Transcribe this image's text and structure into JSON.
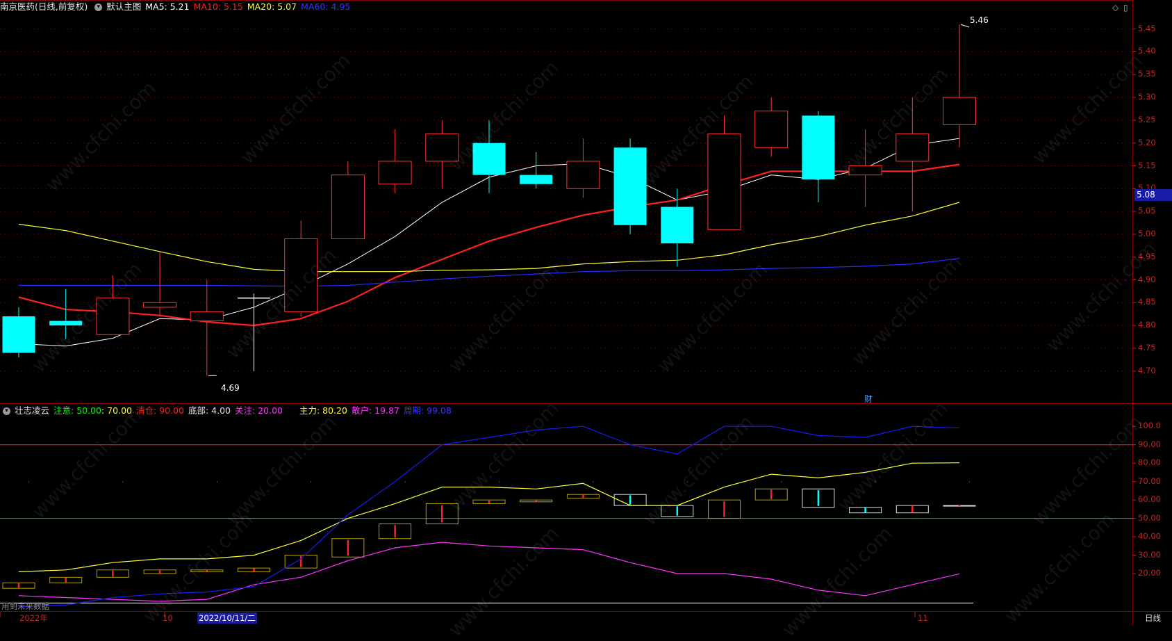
{
  "header": {
    "title": "南京医药(日线,前复权)",
    "template": "默认主图",
    "ma5": "MA5: 5.21",
    "ma10": "MA10: 5.15",
    "ma20": "MA20: 5.07",
    "ma60": "MA60: 4.95"
  },
  "indicator_header": {
    "name": "壮志凌云",
    "attention": "注意: 50.00",
    "attention2": ": 70.00",
    "clear": "清仓: 90.00",
    "bottom": "底部: 4.00",
    "focus": "关注: 20.00",
    "main_force": "主力: 80.20",
    "retail": "散户: 19.87",
    "trend": "周期: 99.08"
  },
  "price_axis": {
    "ticks": [
      "5.45",
      "5.40",
      "5.35",
      "5.30",
      "5.25",
      "5.20",
      "5.15",
      "5.10",
      "5.05",
      "5.00",
      "4.95",
      "4.90",
      "4.85",
      "4.80",
      "4.75",
      "4.70"
    ],
    "current": "5.08"
  },
  "indicator_axis": {
    "ticks": [
      "100.0",
      "90.00",
      "80.00",
      "70.00",
      "60.00",
      "50.00",
      "40.00",
      "30.00",
      "20.00"
    ]
  },
  "annotations": {
    "high": "5.46",
    "low": "4.69",
    "cai": "财",
    "future_data": "用到未来数据"
  },
  "x_axis": {
    "year": "2022年",
    "oct": "10",
    "cursor_date": "2022/10/11/二",
    "nov": "11",
    "period": "日线"
  },
  "watermark": "www.cfchi.com",
  "colors": {
    "up": "#ff3333",
    "down": "#00ffff",
    "ma5": "#ffffff",
    "ma10": "#ff2020",
    "ma20": "#ffff33",
    "ma60": "#2a2aff",
    "retail": "#ff33ff"
  },
  "chart_data": [
    {
      "type": "candlestick",
      "title": "南京医药(日线,前复权)",
      "ylim": [
        4.66,
        5.48
      ],
      "candles": [
        {
          "o": 4.82,
          "h": 4.84,
          "l": 4.73,
          "c": 4.74
        },
        {
          "o": 4.81,
          "h": 4.88,
          "l": 4.77,
          "c": 4.8
        },
        {
          "o": 4.78,
          "h": 4.91,
          "l": 4.78,
          "c": 4.86
        },
        {
          "o": 4.84,
          "h": 4.96,
          "l": 4.82,
          "c": 4.85
        },
        {
          "o": 4.81,
          "h": 4.9,
          "l": 4.69,
          "c": 4.83
        },
        {
          "o": 4.86,
          "h": 4.87,
          "l": 4.7,
          "c": 4.86
        },
        {
          "o": 4.83,
          "h": 5.03,
          "l": 4.82,
          "c": 4.99
        },
        {
          "o": 4.99,
          "h": 5.16,
          "l": 4.99,
          "c": 5.13
        },
        {
          "o": 5.11,
          "h": 5.23,
          "l": 5.09,
          "c": 5.16
        },
        {
          "o": 5.16,
          "h": 5.25,
          "l": 5.1,
          "c": 5.22
        },
        {
          "o": 5.2,
          "h": 5.25,
          "l": 5.09,
          "c": 5.13
        },
        {
          "o": 5.13,
          "h": 5.18,
          "l": 5.1,
          "c": 5.11
        },
        {
          "o": 5.1,
          "h": 5.21,
          "l": 5.08,
          "c": 5.16
        },
        {
          "o": 5.19,
          "h": 5.21,
          "l": 5.0,
          "c": 5.02
        },
        {
          "o": 5.06,
          "h": 5.1,
          "l": 4.93,
          "c": 4.98
        },
        {
          "o": 5.01,
          "h": 5.26,
          "l": 5.01,
          "c": 5.22
        },
        {
          "o": 5.19,
          "h": 5.3,
          "l": 5.17,
          "c": 5.27
        },
        {
          "o": 5.26,
          "h": 5.27,
          "l": 5.07,
          "c": 5.12
        },
        {
          "o": 5.13,
          "h": 5.23,
          "l": 5.06,
          "c": 5.15
        },
        {
          "o": 5.16,
          "h": 5.3,
          "l": 5.05,
          "c": 5.22
        },
        {
          "o": 5.24,
          "h": 5.46,
          "l": 5.19,
          "c": 5.3
        }
      ],
      "series": [
        {
          "name": "MA5",
          "values": [
            4.76,
            4.755,
            4.772,
            4.815,
            4.812,
            4.84,
            4.885,
            4.935,
            4.995,
            5.07,
            5.125,
            5.15,
            5.155,
            5.125,
            5.075,
            5.095,
            5.13,
            5.12,
            5.145,
            5.195,
            5.21
          ]
        },
        {
          "name": "MA10",
          "values": [
            4.862,
            4.835,
            4.83,
            4.822,
            4.808,
            4.8,
            4.815,
            4.853,
            4.905,
            4.945,
            4.985,
            5.015,
            5.042,
            5.06,
            5.075,
            5.108,
            5.138,
            5.138,
            5.138,
            5.138,
            5.153
          ]
        },
        {
          "name": "MA20",
          "values": [
            5.022,
            5.008,
            4.985,
            4.962,
            4.94,
            4.923,
            4.918,
            4.918,
            4.918,
            4.921,
            4.922,
            4.925,
            4.935,
            4.94,
            4.943,
            4.955,
            4.977,
            4.995,
            5.02,
            5.04,
            5.07
          ]
        },
        {
          "name": "MA60",
          "values": [
            4.888,
            4.888,
            4.888,
            4.888,
            4.888,
            4.887,
            4.886,
            4.888,
            4.895,
            4.902,
            4.908,
            4.913,
            4.918,
            4.92,
            4.92,
            4.922,
            4.925,
            4.927,
            4.93,
            4.935,
            4.947
          ]
        }
      ]
    },
    {
      "type": "line",
      "title": "壮志凌云",
      "ylim": [
        0,
        105
      ],
      "hlines": [
        90,
        50,
        4
      ],
      "series": [
        {
          "name": "主力",
          "values": [
            21,
            22,
            26,
            28,
            28,
            30,
            38,
            50,
            58,
            67,
            67,
            66,
            69,
            57,
            57,
            67,
            74,
            72,
            75,
            80,
            80.2
          ]
        },
        {
          "name": "散户",
          "values": [
            8,
            7,
            6,
            5,
            6,
            14,
            18,
            27,
            34,
            37,
            35,
            34,
            33,
            26,
            20,
            20,
            17,
            11,
            8,
            14,
            19.87
          ]
        },
        {
          "name": "周期",
          "values": [
            2,
            3,
            7,
            9,
            10,
            13,
            28,
            52,
            70,
            90,
            94,
            98,
            100,
            90,
            85,
            100,
            100,
            95,
            94,
            100,
            99.08
          ]
        }
      ],
      "bars": [
        {
          "o": 12,
          "c": 15
        },
        {
          "o": 15,
          "c": 18
        },
        {
          "o": 18,
          "c": 22
        },
        {
          "o": 20,
          "c": 22
        },
        {
          "o": 21,
          "c": 22
        },
        {
          "o": 21,
          "c": 23
        },
        {
          "o": 23,
          "c": 30
        },
        {
          "o": 29,
          "c": 39
        },
        {
          "o": 39,
          "c": 47
        },
        {
          "o": 47,
          "c": 58
        },
        {
          "o": 58,
          "c": 60
        },
        {
          "o": 59,
          "c": 60
        },
        {
          "o": 61,
          "c": 63
        },
        {
          "o": 63,
          "c": 57
        },
        {
          "o": 57,
          "c": 51
        },
        {
          "o": 50,
          "c": 60
        },
        {
          "o": 60,
          "c": 66
        },
        {
          "o": 66,
          "c": 56
        },
        {
          "o": 56,
          "c": 53
        },
        {
          "o": 53,
          "c": 57
        },
        {
          "o": 57,
          "c": 57
        }
      ]
    }
  ]
}
